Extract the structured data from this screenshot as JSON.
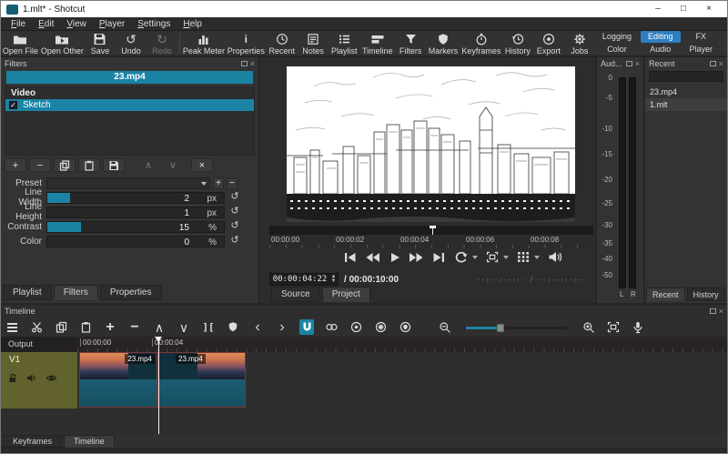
{
  "window": {
    "title": "1.mlt* - Shotcut",
    "minimize_glyph": "–",
    "maximize_glyph": "□",
    "close_glyph": "×"
  },
  "menu": {
    "items": [
      "File",
      "Edit",
      "View",
      "Player",
      "Settings",
      "Help"
    ]
  },
  "toolbar": {
    "open_file": "Open File",
    "open_other": "Open Other",
    "save": "Save",
    "undo": "Undo",
    "redo": "Redo",
    "peak_meter": "Peak Meter",
    "properties": "Properties",
    "recent": "Recent",
    "notes": "Notes",
    "playlist": "Playlist",
    "timeline": "Timeline",
    "filters": "Filters",
    "markers": "Markers",
    "keyframes": "Keyframes",
    "history": "History",
    "export": "Export",
    "jobs": "Jobs",
    "layout_tabs": {
      "logging": "Logging",
      "editing": "Editing",
      "fx": "FX",
      "color": "Color",
      "audio": "Audio",
      "player": "Player",
      "active": "Editing"
    }
  },
  "glyphs": {
    "undo": "↺",
    "redo": "↻",
    "plus": "+",
    "minus": "−",
    "up": "∧",
    "down": "∨",
    "deselect": "×",
    "split": "][",
    "prev": "‹",
    "next": "›",
    "info": "i",
    "check": "✓",
    "spin_up": "▲",
    "spin_down": "▼",
    "close": "×"
  },
  "filters_panel": {
    "title": "Filters",
    "clip_name": "23.mp4",
    "group_label": "Video",
    "filters": [
      {
        "name": "Sketch",
        "enabled": true,
        "selected": true
      }
    ],
    "params": {
      "preset_label": "Preset",
      "rows": [
        {
          "label": "Line Width",
          "value": "2",
          "unit": "px",
          "fill": 13
        },
        {
          "label": "Line Height",
          "value": "1",
          "unit": "px",
          "fill": 0
        },
        {
          "label": "Contrast",
          "value": "15",
          "unit": "%",
          "fill": 19
        },
        {
          "label": "Color",
          "value": "0",
          "unit": "%",
          "fill": 0
        }
      ]
    },
    "tabs": [
      {
        "label": "Playlist"
      },
      {
        "label": "Filters",
        "active": true
      },
      {
        "label": "Properties"
      }
    ]
  },
  "player": {
    "ruler_ticks": [
      "00:00:00",
      "00:00:02",
      "00:00:04",
      "00:00:06",
      "00:00:08"
    ],
    "position": "00:00:04:22",
    "duration_sep": "/",
    "duration": "00:00:10:00",
    "selected_placeholder": "--:--:--:--  /  --:--:--:--",
    "tabs": [
      {
        "label": "Source"
      },
      {
        "label": "Project",
        "active": true
      }
    ]
  },
  "audio_panel": {
    "title": "Aud...",
    "scale": [
      "0",
      "-5",
      "-10",
      "-15",
      "-20",
      "-25",
      "-30",
      "-35",
      "-40",
      "-50"
    ],
    "left_label": "L",
    "right_label": "R"
  },
  "recent_panel": {
    "title": "Recent",
    "items": [
      "23.mp4",
      "1.mlt"
    ],
    "tabs": [
      {
        "label": "Recent",
        "active": true
      },
      {
        "label": "History"
      }
    ]
  },
  "timeline": {
    "title": "Timeline",
    "output_label": "Output",
    "ruler_ticks": [
      "00:00:00",
      "00:00:04"
    ],
    "track_name": "V1",
    "clips": [
      {
        "label": "23.mp4"
      },
      {
        "label": "23.mp4"
      }
    ],
    "bottom_tabs": [
      {
        "label": "Keyframes"
      },
      {
        "label": "Timeline",
        "active": true
      }
    ]
  },
  "colors": {
    "accent": "#1b84a5",
    "editing_blue": "#2e7fc0",
    "track_header": "#61622e",
    "titlebar": "#ffffff"
  }
}
